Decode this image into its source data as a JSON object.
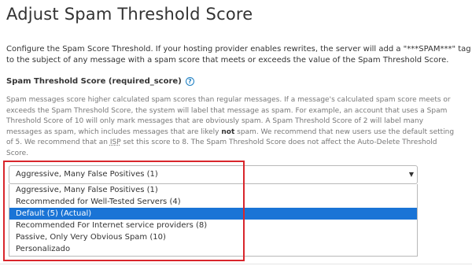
{
  "page": {
    "title": "Adjust Spam Threshold Score",
    "description": "Configure the Spam Score Threshold. If your hosting provider enables rewrites, the server will add a \"***SPAM***\" tag to the subject of any message with a spam score that meets or exceeds the value of the Spam Threshold Score."
  },
  "field": {
    "label": "Spam Threshold Score (required_score)",
    "help_icon": "question-circle-icon",
    "help_part1": "Spam messages score higher calculated spam scores than regular messages. If a message's calculated spam score meets or exceeds the Spam Threshold Score, the system will label that message as spam. For example, an account that uses a Spam Threshold Score of 10 will only mark messages that are obviously spam. A Spam Threshold Score of 2 will label many messages as spam, which includes messages that are likely ",
    "help_bold": "not",
    "help_part2": " spam. We recommend that new users use the default setting of 5. We recommend that an ",
    "help_abbr": "ISP",
    "help_part3": " set this score to 8. The Spam Threshold Score does not affect the Auto-Delete Threshold Score."
  },
  "select": {
    "value": "Aggressive, Many False Positives (1)",
    "arrow_icon": "caret-down-icon",
    "options": [
      "Aggressive, Many False Positives (1)",
      "Recommended for Well-Tested Servers (4)",
      "Default (5) (Actual)",
      "Recommended For Internet service providers (8)",
      "Passive, Only Very Obvious Spam (10)",
      "Personalizado"
    ],
    "highlighted_option": "Default (5) (Actual)"
  },
  "colors": {
    "selection": "#1a74d6",
    "annotation_box": "#d9262c",
    "help_icon": "#1b7ec2"
  }
}
